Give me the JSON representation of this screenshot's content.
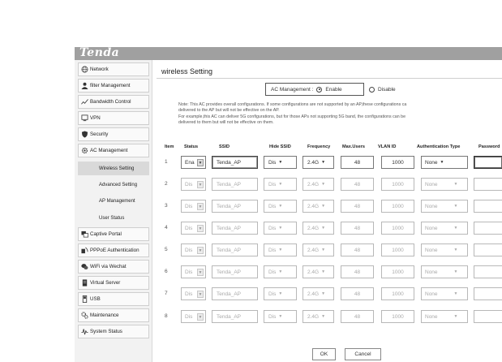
{
  "brand": {
    "logo_text": "Tenda"
  },
  "sidebar": {
    "items": [
      {
        "label": "Network",
        "icon": "globe-icon"
      },
      {
        "label": "filter Management",
        "icon": "user-icon"
      },
      {
        "label": "Bandwidth Control",
        "icon": "wave-icon"
      },
      {
        "label": "VPN",
        "icon": "monitor-icon"
      },
      {
        "label": "Security",
        "icon": "shield-icon"
      },
      {
        "label": "AC Management",
        "icon": "gear-icon"
      }
    ],
    "sub_items": [
      {
        "label": "Wireless Setting",
        "active": true
      },
      {
        "label": "Advanced Setting",
        "active": false
      },
      {
        "label": "AP Management",
        "active": false
      },
      {
        "label": "User Status",
        "active": false
      }
    ],
    "items_after": [
      {
        "label": "Captive Portal",
        "icon": "portal-icon"
      },
      {
        "label": "PPPoE Authentication",
        "icon": "pppoe-icon"
      },
      {
        "label": "WiFi via Wechat",
        "icon": "wechat-icon"
      },
      {
        "label": "Virtual Server",
        "icon": "server-icon"
      },
      {
        "label": "USB",
        "icon": "usb-icon"
      },
      {
        "label": "Maintenance",
        "icon": "tools-icon"
      },
      {
        "label": "System Status",
        "icon": "pulse-icon"
      }
    ]
  },
  "main": {
    "title": "wireless Setting",
    "ac_management": {
      "label": "AC Management :",
      "enable": "Enable",
      "disable": "Disable",
      "selected": "Enable"
    },
    "note_lines": [
      "Note: This AC provides overall configurations. If some configurations are not supported by an AP,these configurations ca",
      "delivered to the AP but will not be effective on the AP.",
      "For example,this AC can deliver 5G configurations, but for those APs not supporting 5G band,  the configurations can be",
      "delivered to them but will not be effective on them."
    ],
    "columns": [
      "Item",
      "Status",
      "SSID",
      "Hide SSID",
      "Frequency",
      "Max.Users",
      "VLAN ID",
      "Authentication Type",
      "Password"
    ],
    "rows": [
      {
        "item": "1",
        "status": "Ena",
        "ssid": "Tenda_AP",
        "hide": "Dis",
        "freq": "2.4G",
        "max": "48",
        "vlan": "1000",
        "auth": "None"
      },
      {
        "item": "2",
        "status": "Dis",
        "ssid": "Tenda_AP",
        "hide": "Dis",
        "freq": "2.4G",
        "max": "48",
        "vlan": "1000",
        "auth": "None"
      },
      {
        "item": "3",
        "status": "Dis",
        "ssid": "Tenda_AP",
        "hide": "Dis",
        "freq": "2.4G",
        "max": "48",
        "vlan": "1000",
        "auth": "None"
      },
      {
        "item": "4",
        "status": "Dis",
        "ssid": "Tenda_AP",
        "hide": "Dis",
        "freq": "2.4G",
        "max": "48",
        "vlan": "1000",
        "auth": "None"
      },
      {
        "item": "5",
        "status": "Dis",
        "ssid": "Tenda_AP",
        "hide": "Dis",
        "freq": "2.4G",
        "max": "48",
        "vlan": "1000",
        "auth": "None"
      },
      {
        "item": "6",
        "status": "Dis",
        "ssid": "Tenda_AP",
        "hide": "Dis",
        "freq": "2.4G",
        "max": "48",
        "vlan": "1000",
        "auth": "None"
      },
      {
        "item": "7",
        "status": "Dis",
        "ssid": "Tenda_AP",
        "hide": "Dis",
        "freq": "2.4G",
        "max": "48",
        "vlan": "1000",
        "auth": "None"
      },
      {
        "item": "8",
        "status": "Dis",
        "ssid": "Tenda_AP",
        "hide": "Dis",
        "freq": "2.4G",
        "max": "48",
        "vlan": "1000",
        "auth": "None"
      }
    ],
    "buttons": {
      "ok": "OK",
      "cancel": "Cancel"
    }
  }
}
